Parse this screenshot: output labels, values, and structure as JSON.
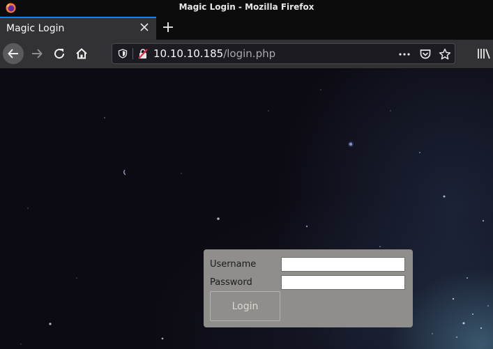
{
  "window": {
    "title": "Magic Login - Mozilla Firefox"
  },
  "tab": {
    "title": "Magic Login",
    "close_icon": "close-icon"
  },
  "navbar": {
    "url_host": "10.10.10.185",
    "url_path": "/login.php",
    "icons": [
      "back-arrow-icon",
      "forward-arrow-icon",
      "reload-icon",
      "home-icon",
      "shield-icon",
      "insecure-lock-icon",
      "more-dots-icon",
      "pocket-icon",
      "star-icon",
      "library-icon"
    ]
  },
  "login": {
    "username_label": "Username",
    "password_label": "Password",
    "username_value": "",
    "password_value": "",
    "button_label": "Login"
  },
  "colors": {
    "tab_accent": "#0a84ff",
    "login_panel": "#8f8e8a",
    "toolbar": "#323234"
  }
}
